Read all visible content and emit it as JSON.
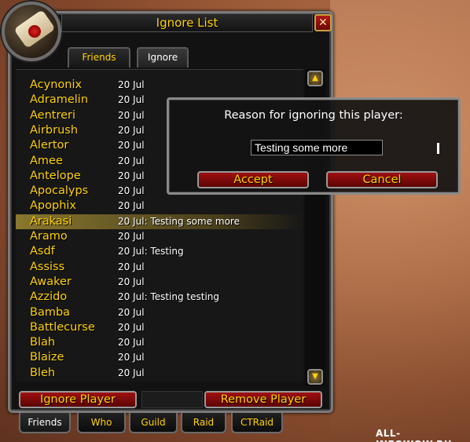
{
  "window": {
    "title": "Ignore List",
    "close_label": "✕"
  },
  "top_tabs": {
    "friends": "Friends",
    "ignore": "Ignore"
  },
  "ignore_list": [
    {
      "name": "Acynonix",
      "note": "20 Jul"
    },
    {
      "name": "Adramelin",
      "note": "20 Jul"
    },
    {
      "name": "Aentreri",
      "note": "20 Jul"
    },
    {
      "name": "Airbrush",
      "note": "20 Jul"
    },
    {
      "name": "Alertor",
      "note": "20 Jul"
    },
    {
      "name": "Amee",
      "note": "20 Jul"
    },
    {
      "name": "Antelope",
      "note": "20 Jul"
    },
    {
      "name": "Apocalyps",
      "note": "20 Jul"
    },
    {
      "name": "Apophix",
      "note": "20 Jul"
    },
    {
      "name": "Arakasi",
      "note": "20 Jul: Testing some more",
      "selected": true
    },
    {
      "name": "Aramo",
      "note": "20 Jul"
    },
    {
      "name": "Asdf",
      "note": "20 Jul: Testing"
    },
    {
      "name": "Assiss",
      "note": "20 Jul"
    },
    {
      "name": "Awaker",
      "note": "20 Jul"
    },
    {
      "name": "Azzido",
      "note": "20 Jul: Testing testing"
    },
    {
      "name": "Bamba",
      "note": "20 Jul"
    },
    {
      "name": "Battlecurse",
      "note": "20 Jul"
    },
    {
      "name": "Blah",
      "note": "20 Jul"
    },
    {
      "name": "Blaize",
      "note": "20 Jul"
    },
    {
      "name": "Bleh",
      "note": "20 Jul"
    }
  ],
  "scrollbar": {
    "up_icon": "▲",
    "down_icon": "▼"
  },
  "buttons": {
    "ignore_player": "Ignore Player",
    "remove_player": "Remove Player"
  },
  "bottom_tabs": [
    "Friends",
    "Who",
    "Guild",
    "Raid",
    "CTRaid"
  ],
  "dialog": {
    "title": "Reason for ignoring this player:",
    "input_value": "Testing some more",
    "accept": "Accept",
    "cancel": "Cancel"
  },
  "watermark": "ALL-INFOWOW.RU",
  "colors": {
    "name_gold": "#ffd100",
    "button_red": "#a01010",
    "selection": "#968232"
  }
}
